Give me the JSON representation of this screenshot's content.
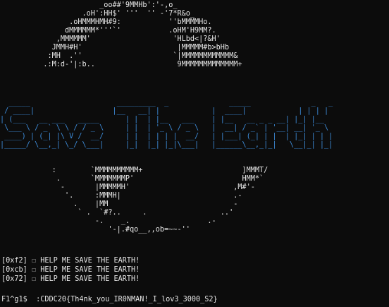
{
  "art": {
    "globe_top": [
      "                       _oo##'9MMHb':'-,o_",
      "                   .oH':HH$' '''  '' -'7*R&o_",
      "                .oHMMMHMH#9:           ''bMMMMHo.",
      "               dMMMMMM*'''`'           .oHM'H9MM?.",
      "             ,MMMMMM'                   'HLbd<|?&H'",
      "            JMMH#H'                      |MMMMM#b>bHb",
      "           :MH  .''                     `|MMMMMMMMMMMM&",
      "          .:M:d-'|:b..                   9MMMMMMMMMMMMM+"
    ],
    "banner": [
      "  _____                    _________  _              _____              _   _     ",
      " / ____|                  |__   __| |            |  ____|            | | | |    ",
      "| (___   __ ___   _____      | |  | |__   ___    | |__   __ _ _ __| |_| |__  ",
      " \\___ \\ / _` \\ \\ / / _ \\     | |  | '_ \\ / _ \\   |  __| / _` | '__| __| '_ \\ ",
      " ____) | (_| |\\ V /  __/     | |  | | | |  __/   | |___| (_| | |  | |_| | | |",
      "|_____/ \\__,_| \\_/ \\___|     |_|  |_| |_|\\___|   |______\\__,_|_|   \\__|_| |_|"
    ],
    "globe_bottom": [
      "            :        `MMMMMMMMMM+                       ]MMMT/",
      "             .       `MMMMMMMP'                         HMM*`",
      "              -       |MMMMMH'                        ,M#'-",
      "               '.     :MMMH|                          .-",
      "                 .    |MM                             -",
      "                  ` .  `#?..     .                 ..'",
      "                      -.    _.                  .-",
      "                         '-|.#qo__,,ob=~~-''"
    ]
  },
  "log_lines": [
    {
      "prefix": "[0xf2] ",
      "glyph": "☐",
      "message": " HELP ME SAVE THE EARTH!"
    },
    {
      "prefix": "[0xcb] ",
      "glyph": "☐",
      "message": " HELP ME SAVE THE EARTH!"
    },
    {
      "prefix": "[0x72] ",
      "glyph": "☐",
      "message": " HELP ME SAVE THE EARTH!"
    }
  ],
  "prompt": {
    "text": "F1^g1$  ",
    "flag": ":CDDC20{Th4nk_you_IR0NMAN!_I_lov3_3000_S2}"
  },
  "colors": {
    "background": "#0c0c0c",
    "foreground": "#e6e6e6",
    "banner": "#3d8bd8"
  }
}
